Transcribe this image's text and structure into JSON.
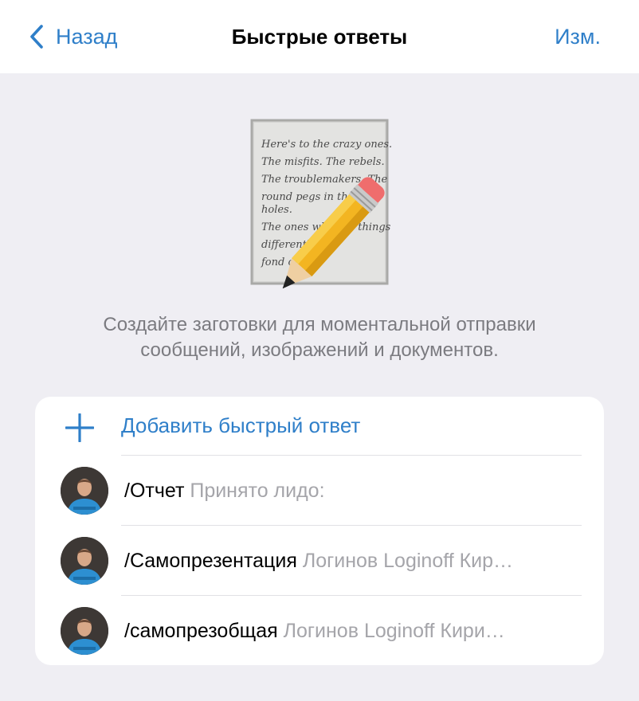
{
  "navbar": {
    "back_label": "Назад",
    "title": "Быстрые ответы",
    "edit_label": "Изм."
  },
  "hero": {
    "icon": "memo-pencil-icon",
    "note_lines": [
      "Here's to the crazy ones.",
      "The misfits. The rebels.",
      "The troublemakers. The",
      "round pegs in the",
      "holes.",
      "The ones who see things",
      "differently...",
      "fond of"
    ]
  },
  "description": {
    "line1": "Создайте заготовки для моментальной отправки",
    "line2": "сообщений, изображений и документов."
  },
  "add_row": {
    "icon": "plus-icon",
    "label": "Добавить быстрый ответ"
  },
  "replies": [
    {
      "shortcut": "/Отчет",
      "preview": "Принято лидо:"
    },
    {
      "shortcut": "/Самопрезентация",
      "preview": "Логинов Loginoff Кир…"
    },
    {
      "shortcut": "/самопрезобщая",
      "preview": "Логинов Loginoff Кири…"
    }
  ],
  "colors": {
    "accent": "#2f7fc9",
    "background": "#efeef3",
    "card": "#ffffff",
    "secondary_text": "#7b7b80",
    "preview_text": "#a5a5aa"
  }
}
